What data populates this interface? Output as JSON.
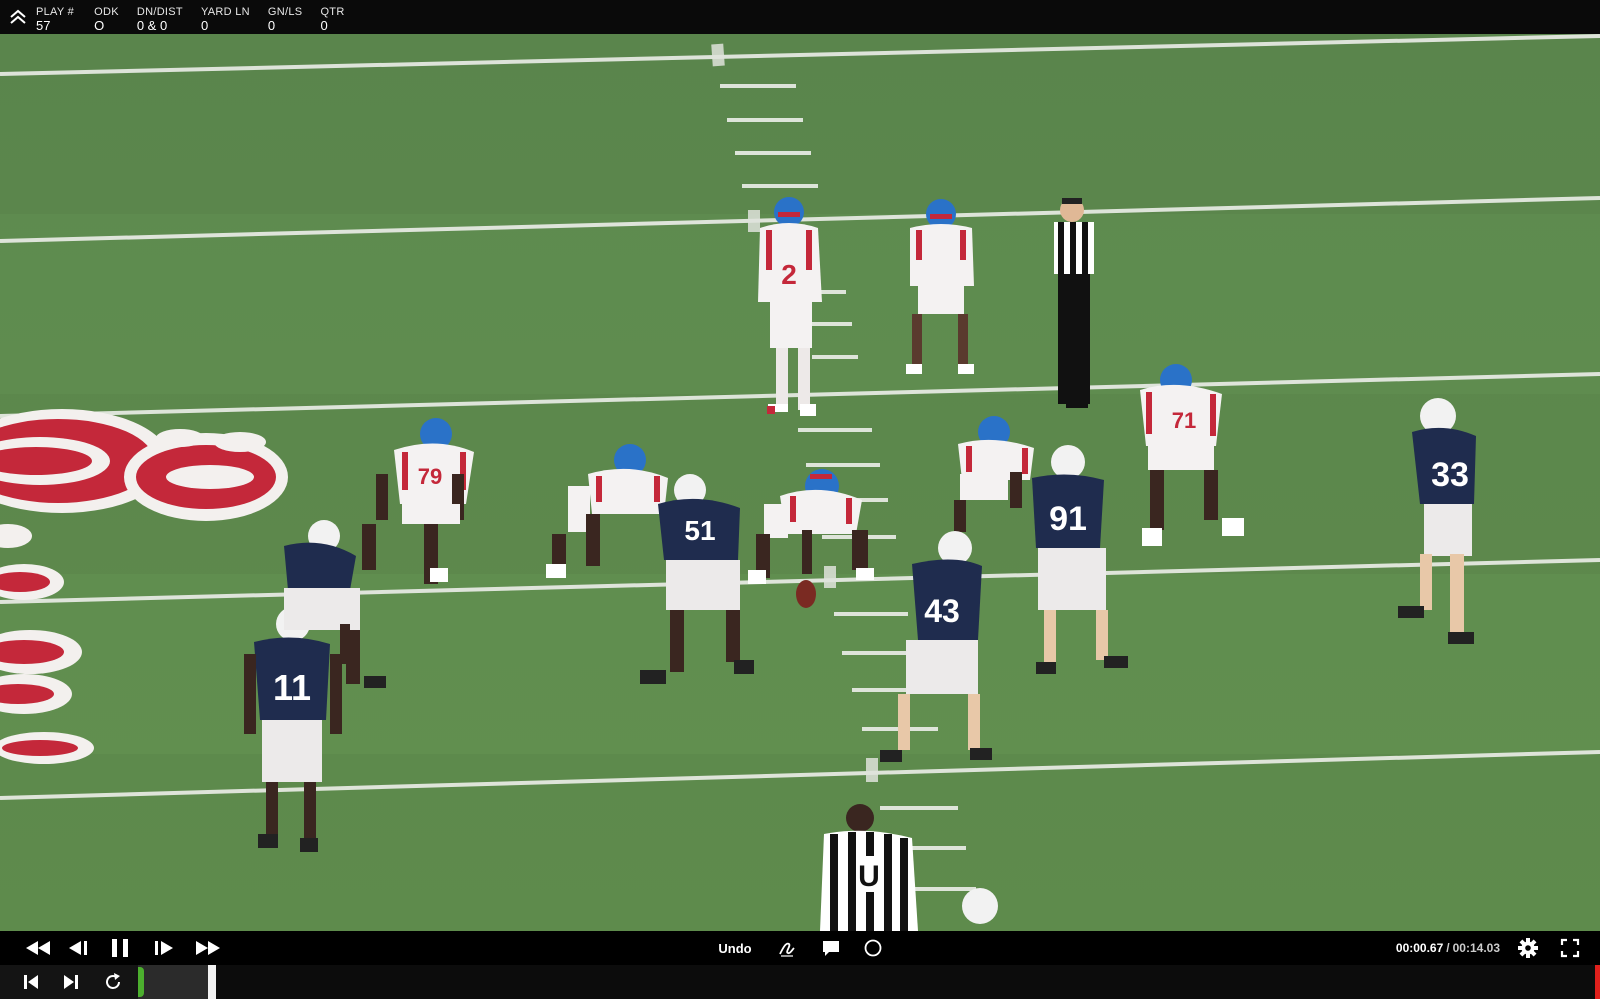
{
  "play_info": {
    "items": [
      {
        "label": "PLAY #",
        "value": "57"
      },
      {
        "label": "ODK",
        "value": "O"
      },
      {
        "label": "DN/DIST",
        "value": "0 & 0"
      },
      {
        "label": "YARD LN",
        "value": "0"
      },
      {
        "label": "GN/LS",
        "value": "0"
      },
      {
        "label": "QTR",
        "value": "0"
      }
    ]
  },
  "video": {
    "field_color": "#5f8a51",
    "offense_jersey_numbers": [
      "2",
      "79",
      "71"
    ],
    "defense_jersey_numbers": [
      "51",
      "91",
      "43",
      "33",
      "11"
    ],
    "official_jersey_letter": "U"
  },
  "controls": {
    "undo_label": "Undo",
    "time_current": "00:00.67",
    "time_separator": "/",
    "time_total": "00:14.03",
    "icons": [
      "rewind-icon",
      "step-back-icon",
      "pause-icon",
      "step-forward-icon",
      "fast-forward-icon",
      "pen-icon",
      "comment-icon",
      "circle-icon",
      "gear-icon",
      "fullscreen-icon"
    ]
  },
  "timeline": {
    "icons": [
      "skip-start-icon",
      "skip-end-icon",
      "loop-icon"
    ],
    "progress_fraction": 0.048,
    "clip_color": "#4caf2e",
    "end_marker_color": "#e0201c"
  }
}
